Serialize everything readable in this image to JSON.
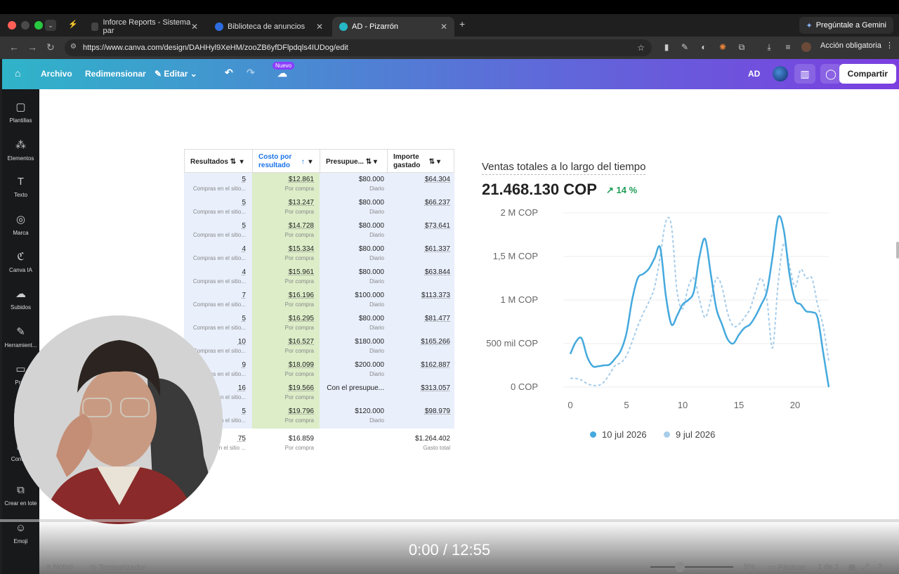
{
  "browser": {
    "tabs": [
      {
        "label": "Inforce Reports - Sistema par"
      },
      {
        "label": "Biblioteca de anuncios"
      },
      {
        "label": "AD - Pizarrón"
      }
    ],
    "gemini_label": "Pregúntale a Gemini",
    "url": "https://www.canva.com/design/DAHHyl9XeHM/zooZB6yfDFlpdqls4IUDog/edit",
    "accion_label": "Acción obligatoria"
  },
  "toolbar": {
    "archivo": "Archivo",
    "redimensionar": "Redimensionar",
    "editar": "Editar",
    "nuevo_badge": "Nuevo",
    "ad_label": "AD",
    "compartir": "Compartir"
  },
  "sidebar": {
    "items": [
      {
        "label": "Plantillas",
        "icon": "template-icon"
      },
      {
        "label": "Elementos",
        "icon": "elements-icon"
      },
      {
        "label": "Texto",
        "icon": "text-icon"
      },
      {
        "label": "Marca",
        "icon": "brand-icon"
      },
      {
        "label": "Canva IA",
        "icon": "canva-ai-icon"
      },
      {
        "label": "Subidos",
        "icon": "upload-icon"
      },
      {
        "label": "Herramient...",
        "icon": "tools-icon"
      },
      {
        "label": "Proy",
        "icon": "folder-icon"
      },
      {
        "label": "Conteni",
        "icon": "content-icon"
      },
      {
        "label": "Crear en lote",
        "icon": "bulk-create-icon"
      },
      {
        "label": "Emoji",
        "icon": "emoji-icon"
      }
    ]
  },
  "table": {
    "headers": [
      "Resultados",
      "Costo por resultado",
      "Presupue...",
      "Importe gastado"
    ],
    "rows": [
      {
        "res": "5",
        "res_sub": "Compras en el sitio...",
        "costo": "$12.861",
        "costo_sub": "Por compra",
        "pres": "$80.000",
        "pres_sub": "Diario",
        "imp": "$64.304"
      },
      {
        "res": "5",
        "res_sub": "Compras en el sitio...",
        "costo": "$13.247",
        "costo_sub": "Por compra",
        "pres": "$80.000",
        "pres_sub": "Diario",
        "imp": "$66.237"
      },
      {
        "res": "5",
        "res_sub": "Compras en el sitio...",
        "costo": "$14.728",
        "costo_sub": "Por compra",
        "pres": "$80.000",
        "pres_sub": "Diario",
        "imp": "$73.641"
      },
      {
        "res": "4",
        "res_sub": "Compras en el sitio...",
        "costo": "$15.334",
        "costo_sub": "Por compra",
        "pres": "$80.000",
        "pres_sub": "Diario",
        "imp": "$61.337"
      },
      {
        "res": "4",
        "res_sub": "Compras en el sitio...",
        "costo": "$15.961",
        "costo_sub": "Por compra",
        "pres": "$80.000",
        "pres_sub": "Diario",
        "imp": "$63.844"
      },
      {
        "res": "7",
        "res_sub": "Compras en el sitio...",
        "costo": "$16.196",
        "costo_sub": "Por compra",
        "pres": "$100.000",
        "pres_sub": "Diario",
        "imp": "$113.373"
      },
      {
        "res": "5",
        "res_sub": "Compras en el sitio...",
        "costo": "$16.295",
        "costo_sub": "Por compra",
        "pres": "$80.000",
        "pres_sub": "Diario",
        "imp": "$81.477"
      },
      {
        "res": "10",
        "res_sub": "Compras en el sitio...",
        "costo": "$16.527",
        "costo_sub": "Por compra",
        "pres": "$180.000",
        "pres_sub": "Diario",
        "imp": "$165.266"
      },
      {
        "res": "9",
        "res_sub": "Compras en el sitio...",
        "costo": "$18.099",
        "costo_sub": "Por compra",
        "pres": "$200.000",
        "pres_sub": "Diario",
        "imp": "$162.887"
      },
      {
        "res": "16",
        "res_sub": "Compras en el sitio...",
        "costo": "$19.566",
        "costo_sub": "Por compra",
        "pres": "Con el presupue...",
        "pres_sub": "",
        "imp": "$313.057"
      },
      {
        "res": "5",
        "res_sub": "Compras en el sitio...",
        "costo": "$19.796",
        "costo_sub": "Por compra",
        "pres": "$120.000",
        "pres_sub": "Diario",
        "imp": "$98.979"
      }
    ],
    "total": {
      "res": "75",
      "res_sub": "Compras en el sitio ...",
      "costo": "$16.859",
      "costo_sub": "Por compra",
      "imp": "$1.264.402",
      "imp_sub": "Gasto total"
    }
  },
  "chart_data": {
    "type": "line",
    "title": "Ventas totales a lo largo del tiempo",
    "total": "21.468.130 COP",
    "change": "14 %",
    "y_ticks": [
      "2 M COP",
      "1,5 M COP",
      "1 M COP",
      "500 mil COP",
      "0 COP"
    ],
    "x_ticks": [
      "0",
      "5",
      "10",
      "15",
      "20"
    ],
    "ylim": [
      0,
      2000000
    ],
    "xlim": [
      0,
      23
    ],
    "series": [
      {
        "name": "10 jul 2026",
        "color": "#45a9dd",
        "dashed": false,
        "x": [
          0,
          0.5,
          1,
          1.5,
          2,
          2.5,
          3,
          3.5,
          4,
          4.5,
          5,
          5.5,
          6,
          6.5,
          7,
          7.5,
          8,
          8.5,
          9,
          9.5,
          10,
          10.5,
          11,
          11.5,
          12,
          12.5,
          13,
          13.5,
          14,
          14.5,
          15,
          15.5,
          16,
          16.5,
          17,
          17.5,
          18,
          18.5,
          19,
          19.5,
          20,
          20.5,
          21,
          21.5,
          22,
          22.5,
          23
        ],
        "y": [
          380000,
          520000,
          560000,
          350000,
          240000,
          240000,
          250000,
          260000,
          330000,
          420000,
          620000,
          1000000,
          1250000,
          1300000,
          1360000,
          1480000,
          1600000,
          1050000,
          720000,
          820000,
          950000,
          1000000,
          1100000,
          1500000,
          1700000,
          1300000,
          900000,
          720000,
          550000,
          500000,
          600000,
          680000,
          720000,
          820000,
          950000,
          1100000,
          1500000,
          1950000,
          1800000,
          1300000,
          1000000,
          950000,
          870000,
          860000,
          800000,
          400000,
          0
        ]
      },
      {
        "name": "9 jul 2026",
        "color": "#a7cdeb",
        "dashed": true,
        "x": [
          0,
          0.5,
          1,
          1.5,
          2,
          2.5,
          3,
          3.5,
          4,
          4.5,
          5,
          5.5,
          6,
          6.5,
          7,
          7.5,
          8,
          8.5,
          9,
          9.5,
          10,
          10.5,
          11,
          11.5,
          12,
          12.5,
          13,
          13.5,
          14,
          14.5,
          15,
          15.5,
          16,
          16.5,
          17,
          17.5,
          18,
          18.5,
          19,
          19.5,
          20,
          20.5,
          21,
          21.5,
          22,
          22.5,
          23
        ],
        "y": [
          100000,
          100000,
          80000,
          40000,
          20000,
          20000,
          60000,
          150000,
          250000,
          280000,
          360000,
          520000,
          700000,
          850000,
          980000,
          1150000,
          1500000,
          1900000,
          1850000,
          1100000,
          900000,
          1150000,
          1250000,
          1000000,
          800000,
          1000000,
          1250000,
          1150000,
          850000,
          700000,
          720000,
          800000,
          900000,
          1100000,
          1250000,
          1000000,
          450000,
          1200000,
          1650000,
          1400000,
          1150000,
          1350000,
          1250000,
          1250000,
          950000,
          700000,
          300000
        ]
      }
    ]
  },
  "video": {
    "time": "0:00 / 12:55"
  },
  "bottombar": {
    "notas": "Notas",
    "temporizador": "Temporizador",
    "zoom": "9%",
    "paginas": "Páginas",
    "page_count": "1 de 1"
  }
}
